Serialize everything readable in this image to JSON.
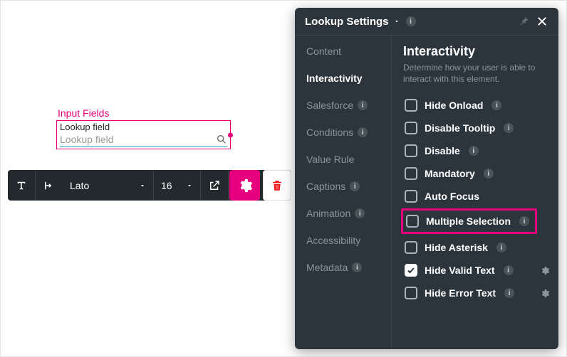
{
  "field": {
    "section_title": "Input Fields",
    "label": "Lookup field",
    "placeholder": "Lookup field"
  },
  "toolbar": {
    "font": "Lato",
    "size": "16"
  },
  "panel": {
    "title": "Lookup Settings",
    "tabs": {
      "content": "Content",
      "interactivity": "Interactivity",
      "salesforce": "Salesforce",
      "conditions": "Conditions",
      "value_rule": "Value Rule",
      "captions": "Captions",
      "animation": "Animation",
      "accessibility": "Accessibility",
      "metadata": "Metadata"
    },
    "pane": {
      "title": "Interactivity",
      "subtitle": "Determine how your user is able to interact with this element.",
      "options": {
        "hide_onload": "Hide Onload",
        "disable_tooltip": "Disable Tooltip",
        "disable": "Disable",
        "mandatory": "Mandatory",
        "auto_focus": "Auto Focus",
        "multiple_selection": "Multiple Selection",
        "hide_asterisk": "Hide Asterisk",
        "hide_valid_text": "Hide Valid Text",
        "hide_error_text": "Hide Error Text"
      }
    }
  }
}
